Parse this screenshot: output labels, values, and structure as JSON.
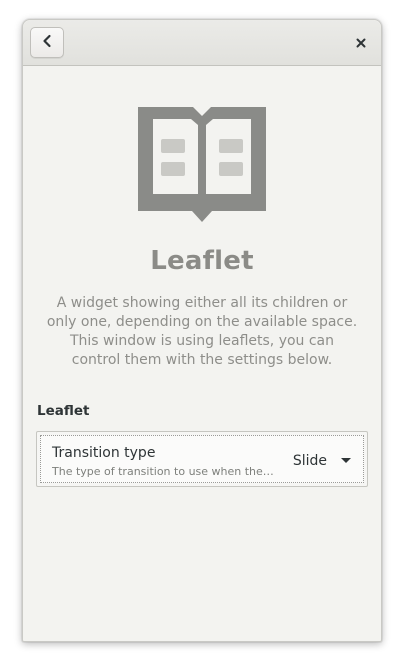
{
  "window": {
    "title": "Leaflet"
  },
  "headerbar": {
    "back_icon": "go-previous-icon",
    "close_icon": "window-close-icon"
  },
  "page": {
    "icon": "book-icon",
    "title": "Leaflet",
    "description": "A widget showing either all its children or only one, depending on the available space. This window is using leaflets, you can control them with the settings below."
  },
  "settings": {
    "section_title": "Leaflet",
    "transition_row": {
      "title": "Transition type",
      "subtitle": "The type of transition to use when the leaflet adapts its size",
      "value": "Slide",
      "options": [
        "Slide"
      ]
    }
  },
  "colors": {
    "window_bg": "#f3f3f0",
    "icon_gray": "#8a8b88",
    "icon_panel": "#c9c9c5",
    "title_gray": "#8b8b87",
    "text_dark": "#2e3436"
  }
}
